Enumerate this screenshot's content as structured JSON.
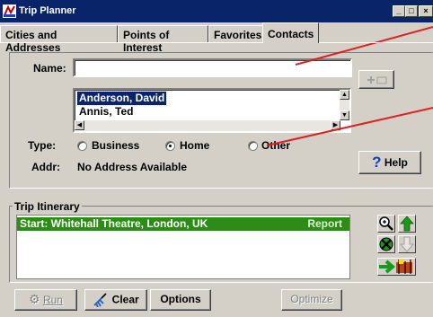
{
  "window": {
    "title": "Trip Planner"
  },
  "tabs": [
    {
      "label": "Cities and Addresses"
    },
    {
      "label": "Points of Interest"
    },
    {
      "label": "Favorites"
    },
    {
      "label": "Contacts"
    }
  ],
  "contacts": {
    "name_label": "Name:",
    "name_value": "",
    "list": [
      "Anderson, David",
      "Annis, Ted"
    ],
    "selected": "Anderson, David",
    "type_label": "Type:",
    "types": [
      {
        "label": "Business",
        "checked": false
      },
      {
        "label": "Home",
        "checked": true
      },
      {
        "label": "Other",
        "checked": false
      }
    ],
    "addr_label": "Addr:",
    "addr_value": "No Address Available",
    "help_label": "Help"
  },
  "itinerary": {
    "group_label": "Trip Itinerary",
    "items": [
      {
        "text": "Start: Whitehall Theatre, London, UK",
        "action": "Report"
      }
    ]
  },
  "bottom": {
    "run_label": "Run",
    "clear_label": "Clear",
    "options_label": "Options",
    "optimize_label": "Optimize"
  },
  "colors": {
    "titlebar": "#0a246a",
    "itinerary_row": "#2e8b17",
    "annotation": "#e02020"
  }
}
